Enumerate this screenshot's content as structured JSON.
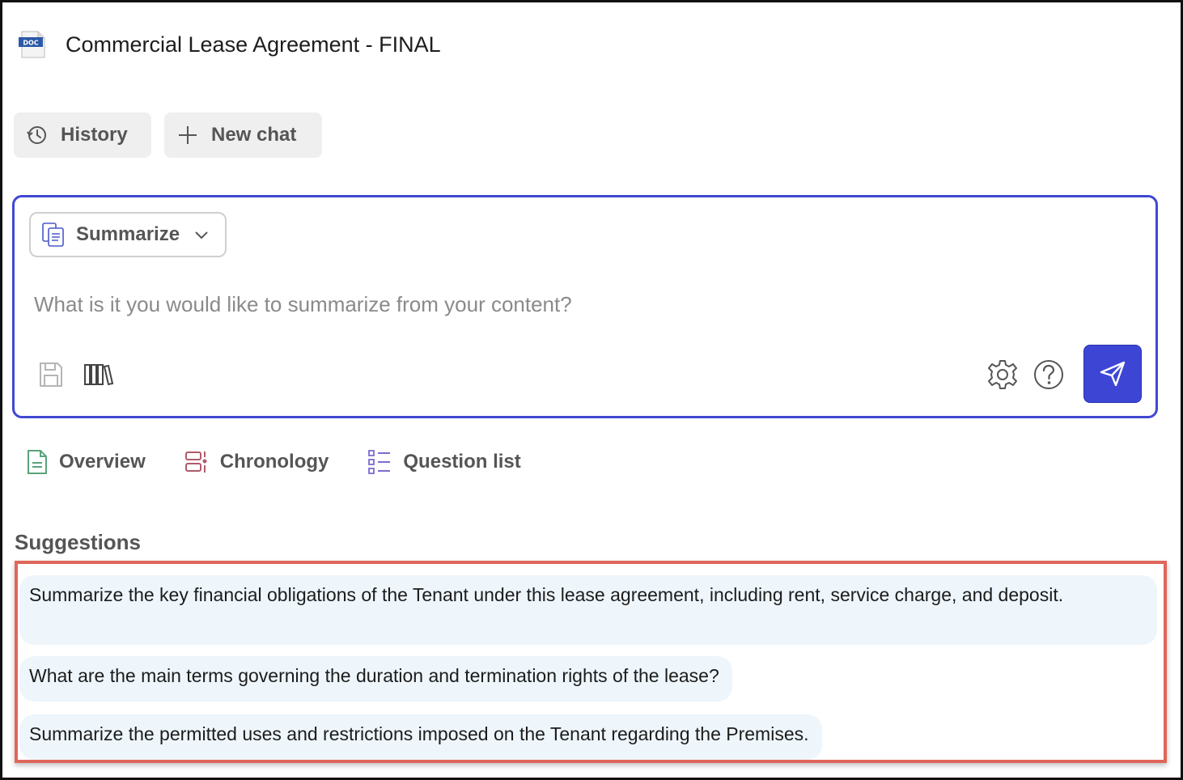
{
  "document": {
    "title": "Commercial Lease Agreement - FINAL",
    "icon_label": "DOC"
  },
  "toolbar": {
    "history_label": "History",
    "new_chat_label": "New chat"
  },
  "composer": {
    "mode": "Summarize",
    "placeholder": "What is it you would like to summarize from your content?",
    "value": ""
  },
  "tabs": [
    {
      "label": "Overview",
      "icon": "document-icon"
    },
    {
      "label": "Chronology",
      "icon": "timeline-icon"
    },
    {
      "label": "Question list",
      "icon": "checklist-icon"
    }
  ],
  "suggestions": {
    "heading": "Suggestions",
    "items": [
      "Summarize the key financial obligations of the Tenant under this lease agreement, including rent, service charge, and deposit.",
      "What are the main terms governing the duration and termination rights of the lease?",
      "Summarize the permitted uses and restrictions imposed on the Tenant regarding the Premises."
    ]
  },
  "colors": {
    "accent": "#3d46d4",
    "highlight_border": "#e0665a",
    "suggestion_bg": "#eef6fc"
  }
}
